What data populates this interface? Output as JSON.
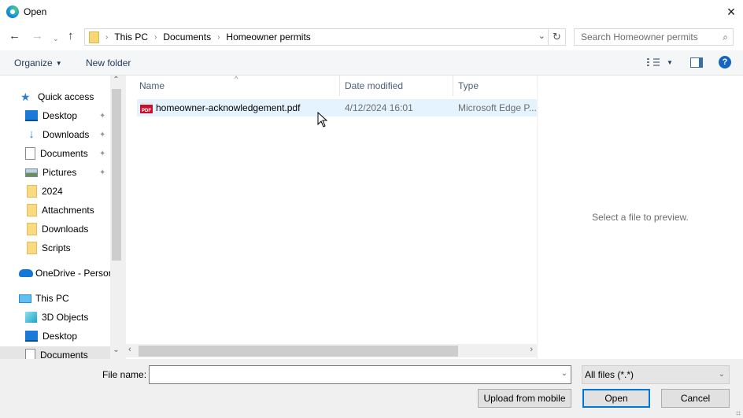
{
  "window": {
    "title": "Open",
    "close_icon": "×"
  },
  "navigation": {
    "back_icon": "←",
    "forward_icon": "→",
    "recent_icon": "⌄",
    "up_icon": "↑",
    "breadcrumb": [
      "This PC",
      "Documents",
      "Homeowner permits"
    ],
    "separator": "›",
    "dropdown_icon": "⌄",
    "refresh_icon": "↻",
    "search_placeholder": "Search Homeowner permits",
    "search_icon": "⌕"
  },
  "toolbar": {
    "organize_label": "Organize",
    "organize_caret": "▼",
    "new_folder_label": "New folder",
    "view_caret": "▼",
    "help_label": "?"
  },
  "sidebar": {
    "scroll_up": "⌃",
    "scroll_down": "⌄",
    "items": [
      {
        "label": "Quick access",
        "icon": "star-icon",
        "glyph": "★",
        "pinned": false
      },
      {
        "label": "Desktop",
        "icon": "desktop-icon",
        "pinned": true
      },
      {
        "label": "Downloads",
        "icon": "download-icon",
        "glyph": "↓",
        "pinned": true
      },
      {
        "label": "Documents",
        "icon": "document-icon",
        "pinned": true
      },
      {
        "label": "Pictures",
        "icon": "pictures-icon",
        "pinned": true
      },
      {
        "label": "2024",
        "icon": "folder-icon",
        "pinned": false
      },
      {
        "label": "Attachments",
        "icon": "folder-icon",
        "pinned": false
      },
      {
        "label": "Downloads",
        "icon": "folder-icon",
        "pinned": false
      },
      {
        "label": "Scripts",
        "icon": "folder-icon",
        "pinned": false
      },
      {
        "label": "OneDrive - Persor",
        "icon": "cloud-icon",
        "pinned": false
      },
      {
        "label": "This PC",
        "icon": "computer-icon",
        "pinned": false
      },
      {
        "label": "3D Objects",
        "icon": "3d-objects-icon",
        "pinned": false
      },
      {
        "label": "Desktop",
        "icon": "desktop-icon",
        "pinned": false
      },
      {
        "label": "Documents",
        "icon": "document-icon",
        "pinned": false,
        "selected": true
      }
    ],
    "pin_glyph": "📌"
  },
  "file_list": {
    "sort_arrow": "^",
    "columns": [
      "Name",
      "Date modified",
      "Type"
    ],
    "rows": [
      {
        "name": "homeowner-acknowledgement.pdf",
        "date": "4/12/2024 16:01",
        "type": "Microsoft Edge P...",
        "icon_label": "PDF"
      }
    ],
    "scroll_left": "‹",
    "scroll_right": "›"
  },
  "preview": {
    "message": "Select a file to preview."
  },
  "footer": {
    "file_name_label": "File name:",
    "file_name_value": "",
    "file_name_dropdown": "⌄",
    "filter_value": "All files (*.*)",
    "filter_dropdown": "⌄",
    "upload_label": "Upload from mobile",
    "open_label": "Open",
    "cancel_label": "Cancel"
  }
}
